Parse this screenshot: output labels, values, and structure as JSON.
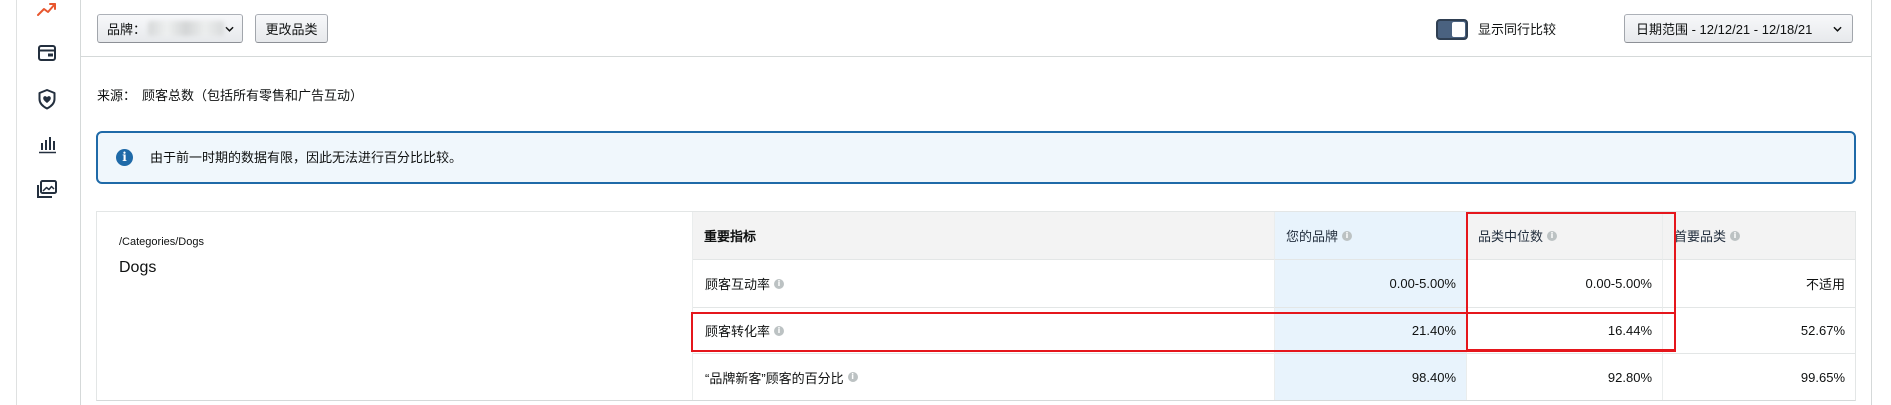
{
  "colors": {
    "accent_blue": "#1f6aa8",
    "notice_bg": "#f0f7fc",
    "brand_column_bg": "#e8f3fc",
    "header_row_bg": "#f3f3f3",
    "annotation_red": "#e5161c",
    "active_icon": "#e8572f",
    "icon_dark": "#232f3e"
  },
  "sidebar": {
    "icons": [
      "trend-up-icon",
      "wallet-icon",
      "shield-heart-icon",
      "bar-chart-icon",
      "image-gallery-icon"
    ]
  },
  "toolbar": {
    "brand_label": "品牌：",
    "change_category_label": "更改品类",
    "peer_comparison_label": "显示同行比较",
    "date_range_label": "日期范围 - 12/12/21 - 12/18/21"
  },
  "source": {
    "label": "来源：",
    "value": "顾客总数（包括所有零售和广告互动）"
  },
  "notice": {
    "icon": "info-circle-icon",
    "text": "由于前一时期的数据有限，因此无法进行百分比比较。"
  },
  "category": {
    "path": "/Categories/Dogs",
    "name": "Dogs"
  },
  "metrics_table": {
    "headers": {
      "metric": "重要指标",
      "your_brand": "您的品牌",
      "category_median": "品类中位数",
      "top_category": "首要品类"
    },
    "rows": [
      {
        "metric": "顾客互动率",
        "your_brand": "0.00-5.00%",
        "category_median": "0.00-5.00%",
        "top_category": "不适用"
      },
      {
        "metric": "顾客转化率",
        "your_brand": "21.40%",
        "category_median": "16.44%",
        "top_category": "52.67%"
      },
      {
        "metric": "“品牌新客”顾客的百分比",
        "your_brand": "98.40%",
        "category_median": "92.80%",
        "top_category": "99.65%"
      }
    ]
  }
}
